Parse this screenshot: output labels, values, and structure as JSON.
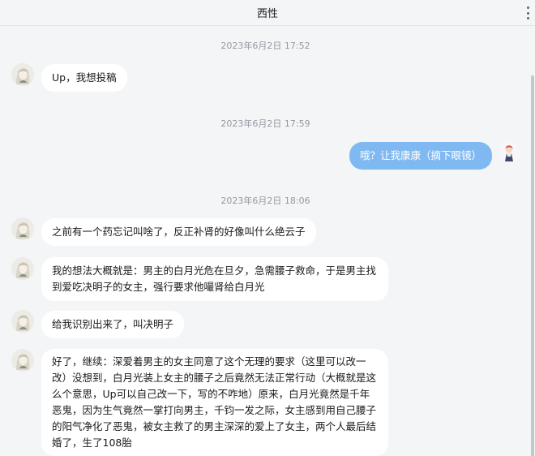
{
  "header": {
    "title": "西性"
  },
  "messages": {
    "ts1": "2023年6月2日 17:52",
    "m1": "Up，我想投稿",
    "ts2": "2023年6月2日 17:59",
    "m2": "哦？让我康康（摘下眼镜）",
    "ts3": "2023年6月2日 18:06",
    "m3": "之前有一个药忘记叫啥了，反正补肾的好像叫什么绝云子",
    "m4": "我的想法大概就是：男主的白月光危在旦夕，急需腰子救命，于是男主找到爱吃决明子的女主，强行要求他嘬肾给白月光",
    "m5": "给我识别出来了，叫决明子",
    "m6": "好了，继续：深爱着男主的女主同意了这个无理的要求（这里可以改一改）没想到，白月光装上女主的腰子之后竟然无法正常行动（大概就是这么个意思，Up可以自己改一下，写的不咋地）原来，白月光竟然是千年恶鬼，因为生气竟然一掌打向男主，千钧一发之际，女主感到用自己腰子的阳气净化了恶鬼，被女主救了的男主深深的爱上了女主，两个人最后结婚了，生了108胎"
  },
  "colors": {
    "self_bubble": "#80b9f2",
    "other_bubble": "#ffffff",
    "background": "#f4f5f7"
  },
  "icons": {
    "more": "more-vertical-icon",
    "user_avatar": "avatar-anime-girl",
    "self_avatar": "avatar-small-figure"
  }
}
